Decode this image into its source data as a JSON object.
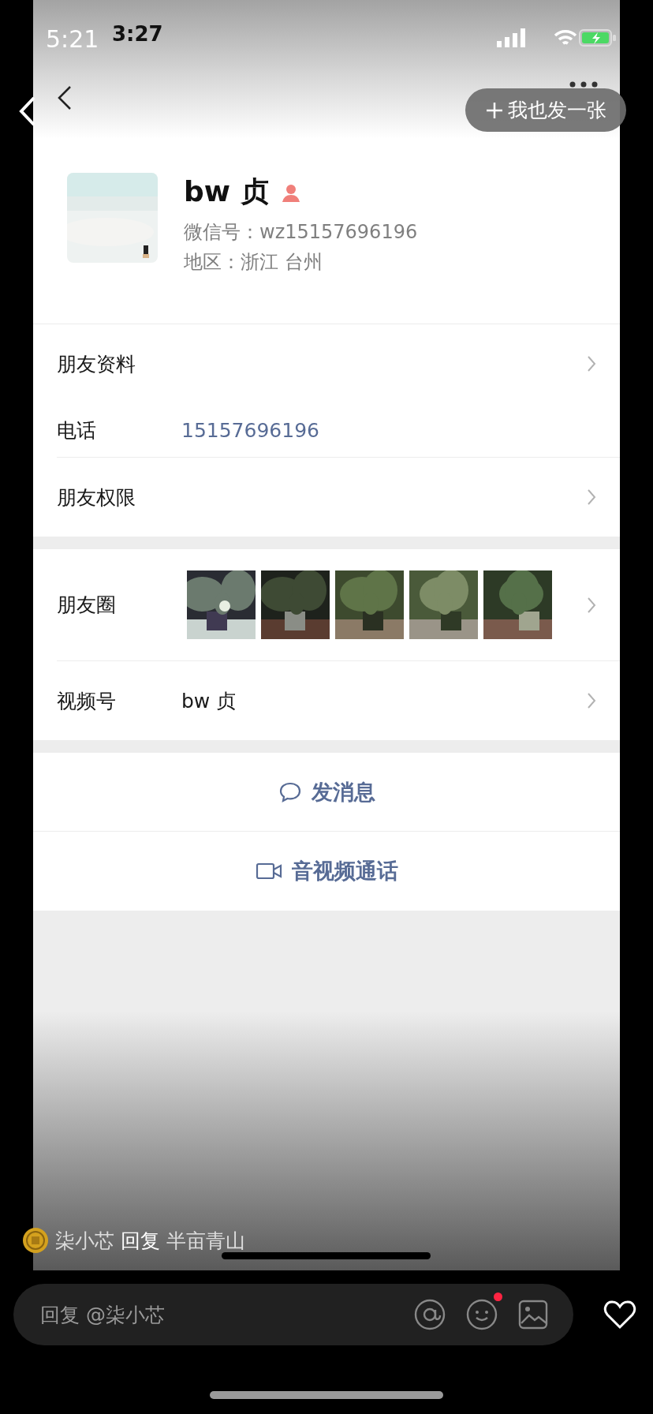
{
  "status_bar": {
    "outer_time": "5:21",
    "inner_time": "3:27"
  },
  "nav": {
    "post_button": "我也发一张"
  },
  "profile": {
    "name": "bw 贞",
    "wechat_id": "微信号：wz15157696196",
    "region": "地区：浙江 台州"
  },
  "sections": [
    {
      "rows": [
        {
          "kind": "link",
          "label": "朋友资料",
          "divider": false
        },
        {
          "kind": "phone",
          "label": "电话",
          "value": "15157696196",
          "divider": true
        },
        {
          "kind": "link",
          "label": "朋友权限",
          "divider": false
        }
      ]
    },
    {
      "rows": [
        {
          "kind": "photos",
          "label": "朋友圈",
          "divider": true
        },
        {
          "kind": "link",
          "label": "视频号",
          "value": "bw 贞",
          "divider": false
        }
      ]
    }
  ],
  "actions": [
    {
      "kind": "chat",
      "label": "发消息"
    },
    {
      "kind": "video",
      "label": "音视频通话"
    }
  ],
  "comment": {
    "user": "柒小芯",
    "verb": "回复",
    "target": "半亩青山"
  },
  "reply_bar": {
    "placeholder": "回复 @柒小芯",
    "emoji_badge": true,
    "liked": false
  }
}
